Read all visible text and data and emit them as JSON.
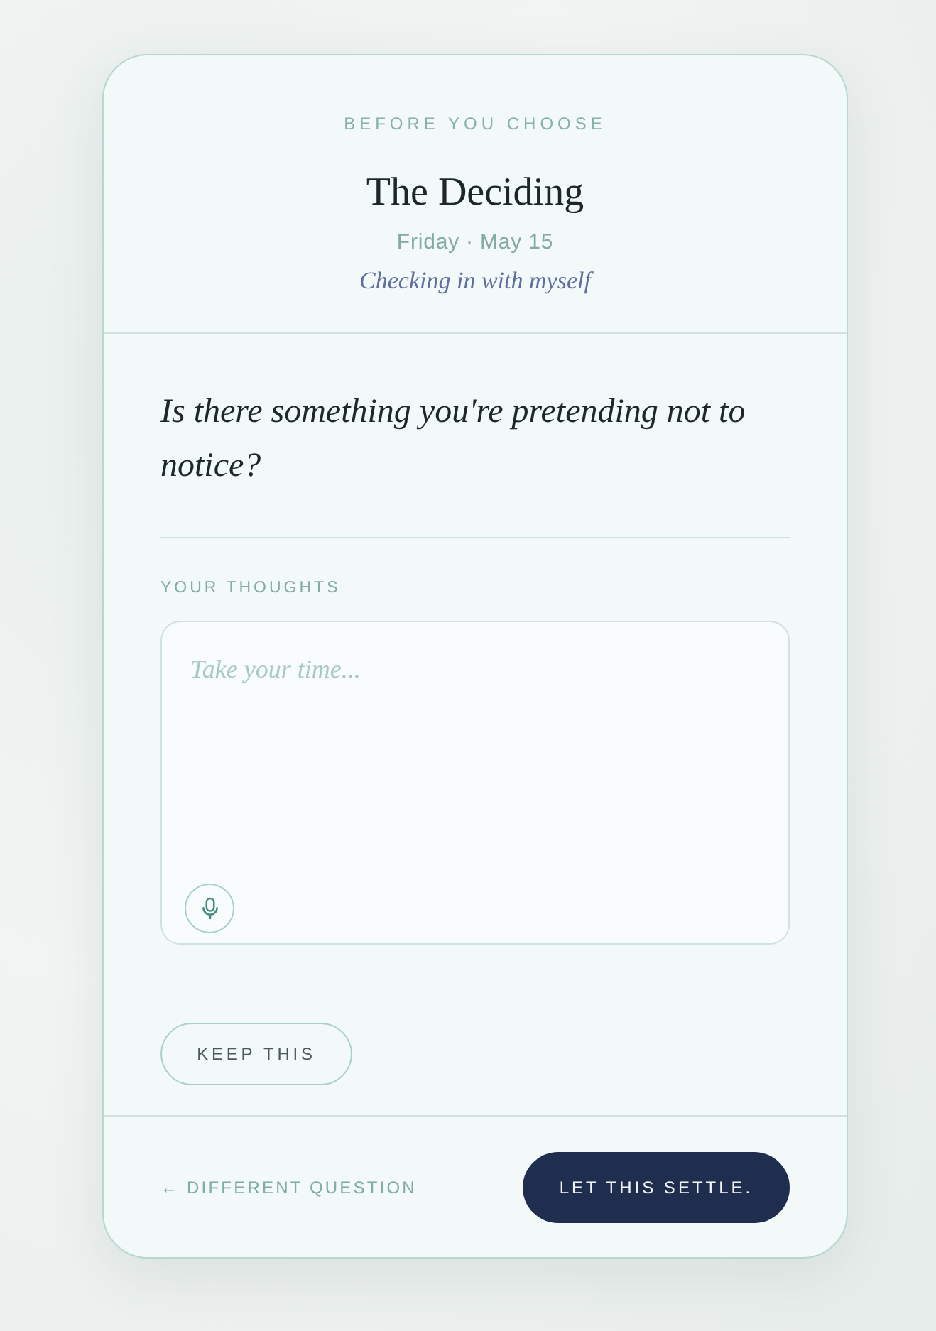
{
  "header": {
    "eyebrow": "BEFORE YOU CHOOSE",
    "title": "The Deciding",
    "date": "Friday · May 15",
    "subtitle": "Checking in with myself"
  },
  "prompt": {
    "question": "Is there something you're pretending not to notice?"
  },
  "thoughts": {
    "label": "YOUR THOUGHTS",
    "placeholder": "Take your time..."
  },
  "actions": {
    "keep_button": "KEEP THIS"
  },
  "footer": {
    "back_link": "← DIFFERENT QUESTION",
    "primary_button": "LET THIS SETTLE."
  }
}
